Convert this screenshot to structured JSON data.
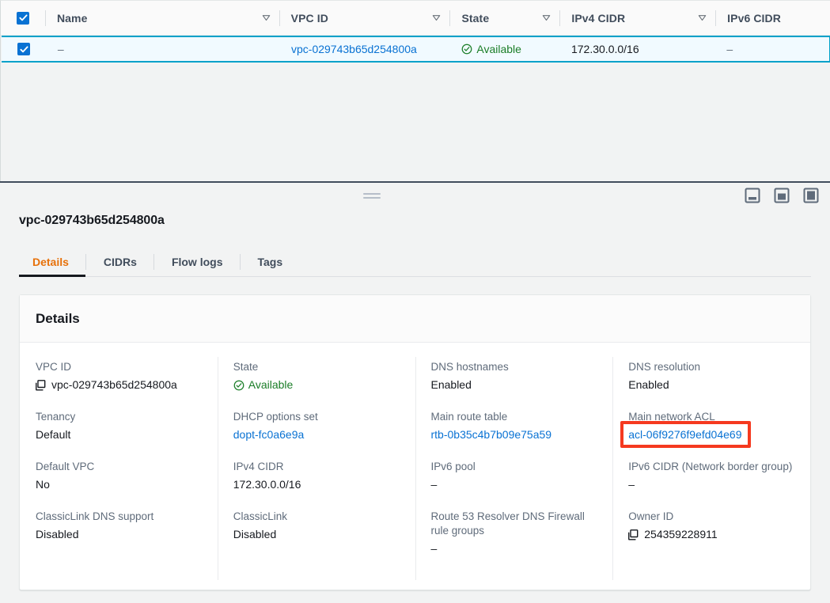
{
  "table": {
    "columns": [
      {
        "id": "select-all",
        "label": "",
        "sortable": false
      },
      {
        "id": "name",
        "label": "Name",
        "sortable": true
      },
      {
        "id": "vpc-id",
        "label": "VPC ID",
        "sortable": true
      },
      {
        "id": "state",
        "label": "State",
        "sortable": true
      },
      {
        "id": "ipv4-cidr",
        "label": "IPv4 CIDR",
        "sortable": true
      },
      {
        "id": "ipv6-cidr",
        "label": "IPv6 CIDR",
        "sortable": false
      }
    ],
    "rows": [
      {
        "selected": true,
        "name": "–",
        "vpc_id": "vpc-029743b65d254800a",
        "state": "Available",
        "ipv4_cidr": "172.30.0.0/16",
        "ipv6_cidr": "–"
      }
    ],
    "select_all_checked": true
  },
  "splitter": {
    "drag_handle": "resize-handle",
    "panel_size_buttons": [
      "panel-small",
      "panel-medium",
      "panel-large"
    ]
  },
  "detail": {
    "resource_title": "vpc-029743b65d254800a",
    "tabs": [
      {
        "label": "Details",
        "active": true
      },
      {
        "label": "CIDRs",
        "active": false
      },
      {
        "label": "Flow logs",
        "active": false
      },
      {
        "label": "Tags",
        "active": false
      }
    ],
    "card_title": "Details",
    "columns": [
      [
        {
          "label": "VPC ID",
          "value": "vpc-029743b65d254800a",
          "type": "copyable"
        },
        {
          "label": "Tenancy",
          "value": "Default",
          "type": "text"
        },
        {
          "label": "Default VPC",
          "value": "No",
          "type": "text"
        },
        {
          "label": "ClassicLink DNS support",
          "value": "Disabled",
          "type": "text"
        }
      ],
      [
        {
          "label": "State",
          "value": "Available",
          "type": "status-ok"
        },
        {
          "label": "DHCP options set",
          "value": "dopt-fc0a6e9a",
          "type": "link"
        },
        {
          "label": "IPv4 CIDR",
          "value": "172.30.0.0/16",
          "type": "text"
        },
        {
          "label": "ClassicLink",
          "value": "Disabled",
          "type": "text"
        }
      ],
      [
        {
          "label": "DNS hostnames",
          "value": "Enabled",
          "type": "text"
        },
        {
          "label": "Main route table",
          "value": "rtb-0b35c4b7b09e75a59",
          "type": "link"
        },
        {
          "label": "IPv6 pool",
          "value": "–",
          "type": "text"
        },
        {
          "label": "Route 53 Resolver DNS Firewall rule groups",
          "value": "–",
          "type": "text"
        }
      ],
      [
        {
          "label": "DNS resolution",
          "value": "Enabled",
          "type": "text"
        },
        {
          "label": "Main network ACL",
          "value": "acl-06f9276f9efd04e69",
          "type": "link",
          "highlighted": true
        },
        {
          "label": "IPv6 CIDR (Network border group)",
          "value": "–",
          "type": "text"
        },
        {
          "label": "Owner ID",
          "value": "254359228911",
          "type": "copyable"
        }
      ]
    ]
  },
  "colors": {
    "link": "#0972d3",
    "status_ok": "#1a7d27",
    "active_tab": "#e7710a",
    "selection_border": "#00a1c9",
    "selection_bg": "#f1faff",
    "highlight_box": "#f5391f"
  }
}
